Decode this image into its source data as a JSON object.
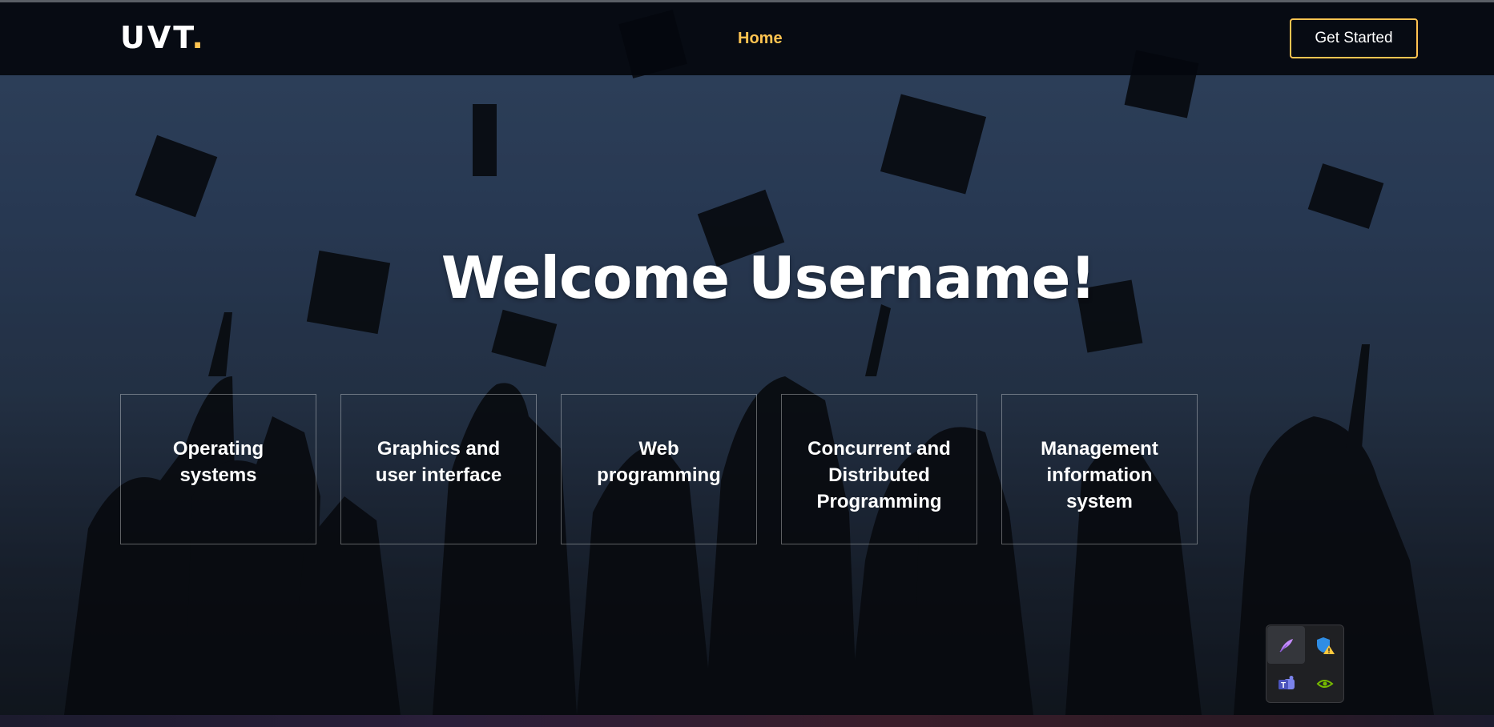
{
  "header": {
    "logo_text": "UVT",
    "logo_dot": ".",
    "nav": {
      "home": "Home"
    },
    "cta": "Get Started"
  },
  "hero": {
    "title": "Welcome Username!"
  },
  "courses": [
    {
      "label": "Operating systems"
    },
    {
      "label": "Graphics and user interface"
    },
    {
      "label": "Web programming"
    },
    {
      "label": "Concurrent and Distributed Programming"
    },
    {
      "label": "Management information system"
    }
  ],
  "tray": {
    "icons": [
      "feather-app-icon",
      "security-warning-icon",
      "teams-icon",
      "nvidia-icon"
    ]
  },
  "colors": {
    "accent": "#ffc451",
    "header_bg": "#0b1018",
    "sky_top": "#3d5677",
    "sky_bottom": "#121820"
  }
}
